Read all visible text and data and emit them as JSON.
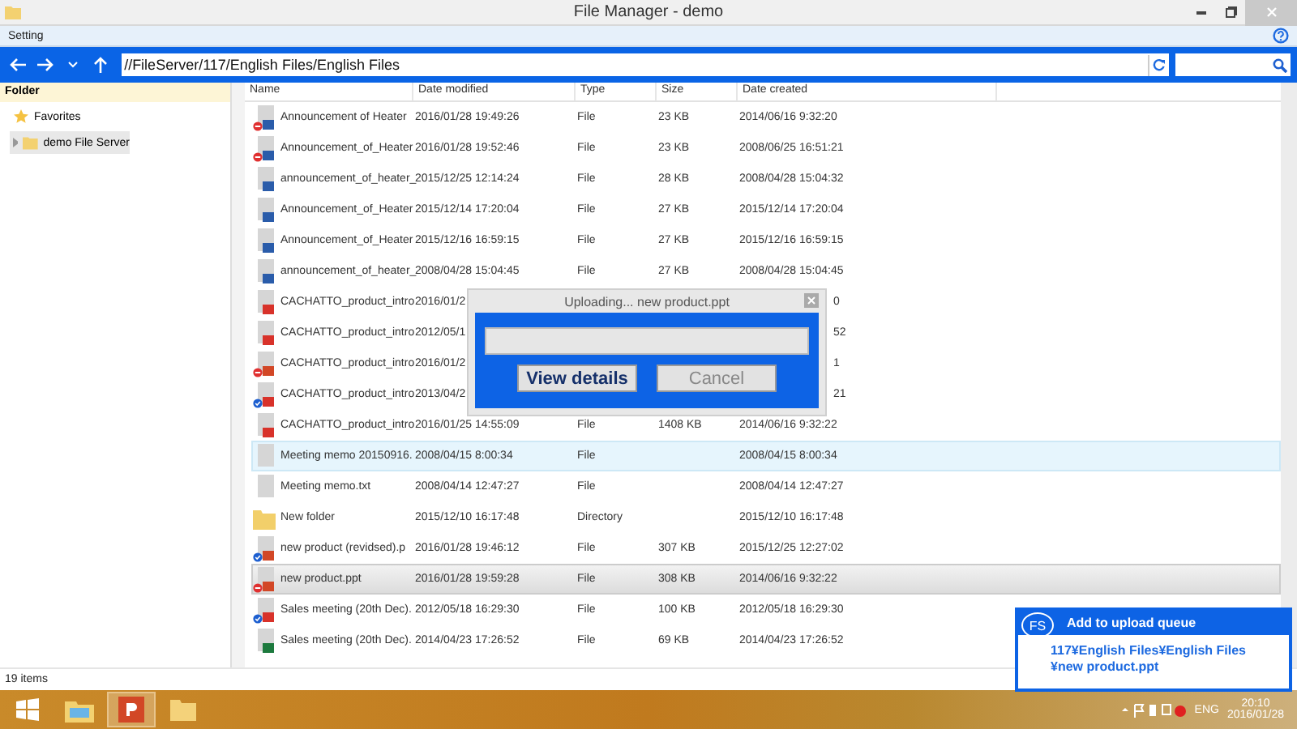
{
  "window": {
    "title": "File Manager - demo"
  },
  "menu": [
    "Setting"
  ],
  "address": {
    "path": "//FileServer/117/English Files/English Files"
  },
  "sidebar": {
    "header": "Folder",
    "items": [
      {
        "label": "Favorites",
        "kind": "favorites",
        "selected": false
      },
      {
        "label": "demo File Server",
        "kind": "server",
        "selected": true
      }
    ]
  },
  "columns": [
    "Name",
    "Date modified",
    "Type",
    "Size",
    "Date created"
  ],
  "rows": [
    {
      "name": "Announcement of Heater",
      "modified": "2016/01/28 19:49:26",
      "type": "File",
      "size": "23 KB",
      "created": "2014/06/16 9:32:20",
      "kind": "doc",
      "sync_error": true,
      "synced": false,
      "selected": false,
      "hovered": false
    },
    {
      "name": "Announcement_of_Heater",
      "modified": "2016/01/28 19:52:46",
      "type": "File",
      "size": "23 KB",
      "created": "2008/06/25 16:51:21",
      "kind": "doc",
      "sync_error": true,
      "synced": false,
      "selected": false,
      "hovered": false
    },
    {
      "name": "announcement_of_heater_",
      "modified": "2015/12/25 12:14:24",
      "type": "File",
      "size": "28 KB",
      "created": "2008/04/28 15:04:32",
      "kind": "doc",
      "sync_error": false,
      "synced": false,
      "selected": false,
      "hovered": false
    },
    {
      "name": "Announcement_of_Heater",
      "modified": "2015/12/14 17:20:04",
      "type": "File",
      "size": "27 KB",
      "created": "2015/12/14 17:20:04",
      "kind": "doc",
      "sync_error": false,
      "synced": false,
      "selected": false,
      "hovered": false
    },
    {
      "name": "Announcement_of_Heater",
      "modified": "2015/12/16 16:59:15",
      "type": "File",
      "size": "27 KB",
      "created": "2015/12/16 16:59:15",
      "kind": "doc",
      "sync_error": false,
      "synced": false,
      "selected": false,
      "hovered": false
    },
    {
      "name": "announcement_of_heater_",
      "modified": "2008/04/28 15:04:45",
      "type": "File",
      "size": "27 KB",
      "created": "2008/04/28 15:04:45",
      "kind": "doc",
      "sync_error": false,
      "synced": false,
      "selected": false,
      "hovered": false
    },
    {
      "name": "CACHATTO_product_intro",
      "modified": "2016/01/2",
      "created_tail": "0",
      "kind": "pdf",
      "sync_error": false,
      "synced": false,
      "selected": false,
      "hovered": false
    },
    {
      "name": "CACHATTO_product_intro",
      "modified": "2012/05/1",
      "created_tail": "52",
      "kind": "pdf",
      "sync_error": false,
      "synced": false,
      "selected": false,
      "hovered": false
    },
    {
      "name": "CACHATTO_product_intro",
      "modified": "2016/01/2",
      "created_tail": "1",
      "kind": "ppt",
      "sync_error": true,
      "synced": false,
      "selected": false,
      "hovered": false
    },
    {
      "name": "CACHATTO_product_intro",
      "modified": "2013/04/2",
      "created_tail": "21",
      "kind": "pdf",
      "sync_error": false,
      "synced": true,
      "selected": false,
      "hovered": false
    },
    {
      "name": "CACHATTO_product_intro",
      "modified": "2016/01/25 14:55:09",
      "type": "File",
      "size": "1408 KB",
      "created": "2014/06/16 9:32:22",
      "kind": "pdf",
      "sync_error": false,
      "synced": false,
      "selected": false,
      "hovered": false
    },
    {
      "name": "Meeting memo 20150916.",
      "modified": "2008/04/15 8:00:34",
      "type": "File",
      "created": "2008/04/15 8:00:34",
      "kind": "plain",
      "sync_error": false,
      "synced": false,
      "selected": false,
      "hovered": true
    },
    {
      "name": "Meeting memo.txt",
      "modified": "2008/04/14 12:47:27",
      "type": "File",
      "created": "2008/04/14 12:47:27",
      "kind": "plain",
      "sync_error": false,
      "synced": false,
      "selected": false,
      "hovered": false
    },
    {
      "name": "New folder",
      "modified": "2015/12/10 16:17:48",
      "type": "Directory",
      "created": "2015/12/10 16:17:48",
      "kind": "folder",
      "sync_error": false,
      "synced": false,
      "selected": false,
      "hovered": false
    },
    {
      "name": "new product (revidsed).p",
      "modified": "2016/01/28 19:46:12",
      "type": "File",
      "size": "307 KB",
      "created": "2015/12/25 12:27:02",
      "kind": "ppt",
      "sync_error": false,
      "synced": true,
      "selected": false,
      "hovered": false
    },
    {
      "name": "new product.ppt",
      "modified": "2016/01/28 19:59:28",
      "type": "File",
      "size": "308 KB",
      "created": "2014/06/16 9:32:22",
      "kind": "ppt",
      "sync_error": true,
      "synced": false,
      "selected": true,
      "hovered": false
    },
    {
      "name": "Sales meeting (20th Dec).",
      "modified": "2012/05/18 16:29:30",
      "type": "File",
      "size": "100 KB",
      "created": "2012/05/18 16:29:30",
      "kind": "pdf",
      "sync_error": false,
      "synced": true,
      "selected": false,
      "hovered": false
    },
    {
      "name": "Sales meeting (20th Dec).",
      "modified": "2014/04/23 17:26:52",
      "type": "File",
      "size": "69 KB",
      "created": "2014/04/23 17:26:52",
      "kind": "xls",
      "sync_error": false,
      "synced": false,
      "selected": false,
      "hovered": false
    }
  ],
  "status_bar": "19 items",
  "dialog": {
    "title": "Uploading... new product.ppt",
    "level": 0,
    "buttons": [
      {
        "label": "View details",
        "disabled": false
      },
      {
        "label": "Cancel",
        "disabled": true
      }
    ]
  },
  "toast": {
    "logo": "FS",
    "title": "Add to upload queue",
    "lines": [
      "117¥English Files¥English Files",
      "¥new product.ppt"
    ]
  },
  "taskbar": {
    "apps": [
      {
        "kind": "start"
      },
      {
        "kind": "explorer"
      },
      {
        "kind": "powerpoint",
        "selected": true
      },
      {
        "kind": "folder"
      }
    ],
    "language": "ENG",
    "time": "20:10",
    "date": "2016/01/28"
  }
}
